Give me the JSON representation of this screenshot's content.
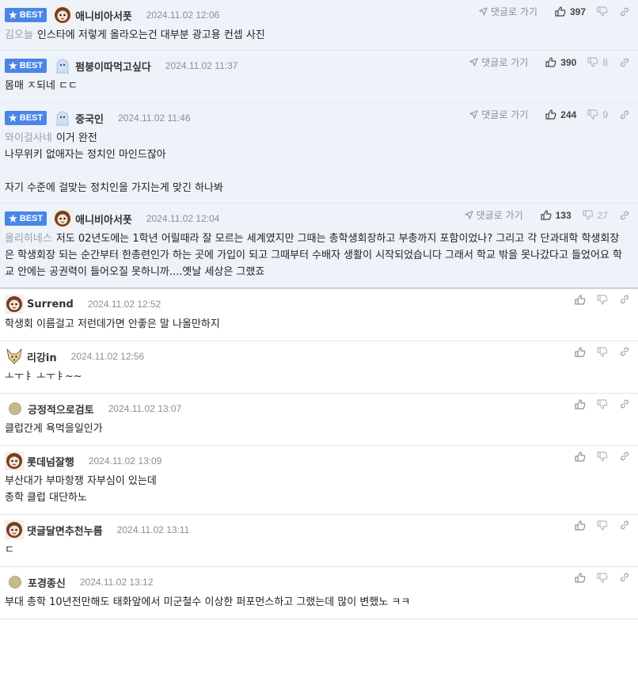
{
  "labels": {
    "best": "BEST",
    "reply": "댓글로 가기"
  },
  "colors": {
    "best_badge": "#4a86e8",
    "best_bg": "#eef2f9"
  },
  "comments": [
    {
      "best": true,
      "nick": "애니비아서폿",
      "avatar": "lion-avatar",
      "date": "2024.11.02 12:06",
      "up": "397",
      "down": "",
      "mention": "김오늘",
      "lines": [
        "인스타에 저렇게 올라오는건 대부분 광고용 컨셉 사진"
      ],
      "pad": 8
    },
    {
      "best": true,
      "nick": "펌붕이따먹고싶다",
      "avatar": "ghost-avatar",
      "date": "2024.11.02 11:37",
      "up": "390",
      "down": "8",
      "mention": "",
      "lines": [
        "몸매 ㅈ되네 ㄷㄷ"
      ],
      "pad": 10
    },
    {
      "best": true,
      "nick": "중국인",
      "avatar": "ghost-avatar",
      "date": "2024.11.02 11:46",
      "up": "244",
      "down": "9",
      "mention": "와이걸사네",
      "lines": [
        "이거 완전",
        "나무위키 없애자는 정치인 마인드잖아",
        "",
        "자기 수준에 걸맞는 정치인을 가지는게 맞긴 하나봐"
      ],
      "pad": 8
    },
    {
      "best": true,
      "nick": "애니비아서폿",
      "avatar": "lion-avatar",
      "date": "2024.11.02 12:04",
      "up": "133",
      "down": "27",
      "mention": "올리히네스",
      "lines": [
        "저도 02년도에는 1학년 어릴때라 잘 모르는 세계였지만 그때는 총학생회장하고 부총까지 포함이었나? 그리고 각 단과대학 학생회장은 학생회장 되는 순간부터 한총련인가 하는 곳에 가입이 되고 그때부터 수배자 생활이 시작되었습니다 그래서 학교 밖을 못나갔다고 들었어요 학교 안에는 공권력이 들어오질 못하니까....옛날 세상은 그랬죠"
      ],
      "pad": 8
    },
    {
      "best": false,
      "nick": "Surrend",
      "avatar": "lion-avatar",
      "date": "2024.11.02 12:52",
      "up": "",
      "down": "",
      "mention": "",
      "lines": [
        "학생회 이름걸고 저런데가면 안좋은 말 나올만하지"
      ],
      "pad": 10
    },
    {
      "best": false,
      "nick": "리강in",
      "avatar": "fox-avatar",
      "date": "2024.11.02 12:56",
      "up": "",
      "down": "",
      "mention": "",
      "lines": [
        "ㅗㅜㅑ ㅗㅜㅑ~~"
      ],
      "pad": 10
    },
    {
      "best": false,
      "nick": "긍정적으로검토",
      "avatar": "dot-avatar",
      "date": "2024.11.02 13:07",
      "up": "",
      "down": "",
      "mention": "",
      "lines": [
        "클럽간게 욕먹을일인가"
      ],
      "pad": 10
    },
    {
      "best": false,
      "nick": "롯데넘잘행",
      "avatar": "lion-avatar",
      "date": "2024.11.02 13:09",
      "up": "",
      "down": "",
      "mention": "",
      "lines": [
        "부산대가 부마항쟁 자부심이 있는데",
        "총학 클럽 대단하노"
      ],
      "pad": 10
    },
    {
      "best": false,
      "nick": "댓글달면추천누름",
      "avatar": "lion-avatar",
      "date": "2024.11.02 13:11",
      "up": "",
      "down": "",
      "mention": "",
      "lines": [
        "ㄷ"
      ],
      "pad": 10
    },
    {
      "best": false,
      "nick": "포경종신",
      "avatar": "dot-avatar",
      "date": "2024.11.02 13:12",
      "up": "",
      "down": "",
      "mention": "",
      "lines": [
        "부대 총학 10년전만해도 태화앞에서 미군철수 이상한 퍼포먼스하고 그랬는데 많이 변했노 ㅋㅋ"
      ],
      "pad": 10
    }
  ]
}
